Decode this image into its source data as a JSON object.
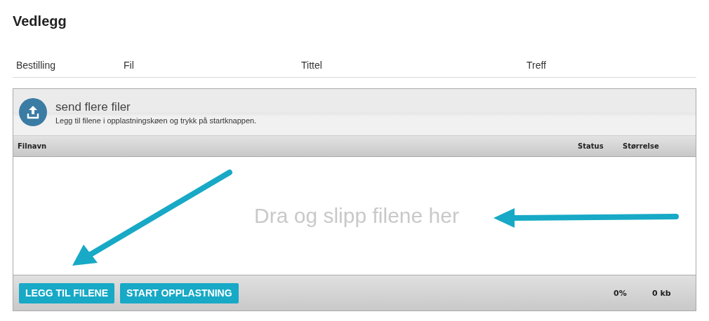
{
  "title": "Vedlegg",
  "columns": [
    "Bestilling",
    "Fil",
    "Tittel",
    "Treff"
  ],
  "uploader": {
    "title": "send flere filer",
    "subtitle": "Legg til filene i opplastningskøen og trykk på startknappen.",
    "file_columns": [
      "Filnavn",
      "Status",
      "Størrelse"
    ],
    "drop_hint": "Dra og slipp filene her",
    "buttons": [
      "LEGG TIL FILENE",
      "START OPPLASTNING"
    ],
    "progress": "0%",
    "total_size": "0 kb"
  }
}
